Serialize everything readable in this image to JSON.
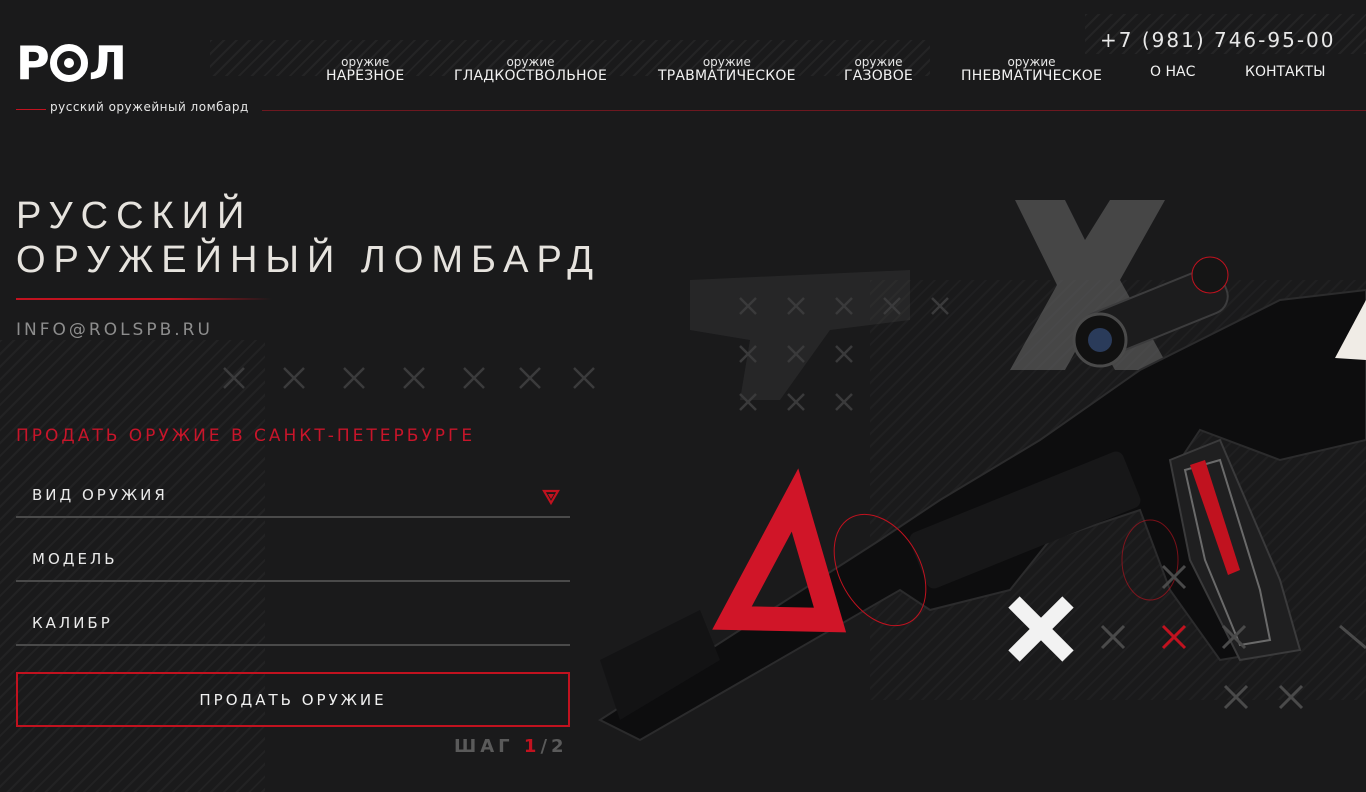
{
  "header": {
    "logo_text": "РОЛ",
    "logo_subtitle": "русский оружейный ломбард",
    "phone": "+7 (981) 746-95-00",
    "nav": [
      {
        "small": "оружие",
        "label": "НАРЕЗНОЕ"
      },
      {
        "small": "оружие",
        "label": "ГЛАДКОСТВОЛЬНОЕ"
      },
      {
        "small": "оружие",
        "label": "ТРАВМАТИЧЕСКОЕ"
      },
      {
        "small": "оружие",
        "label": "ГАЗОВОЕ"
      },
      {
        "small": "оружие",
        "label": "ПНЕВМАТИЧЕСКОЕ"
      }
    ],
    "about": "О НАС",
    "contacts": "КОНТАКТЫ"
  },
  "hero": {
    "title_line1": "РУССКИЙ",
    "title_line2": "ОРУЖЕЙНЫЙ ЛОМБАРД",
    "email": "INFO@ROLSPB.RU"
  },
  "form": {
    "title": "ПРОДАТЬ ОРУЖИЕ В САНКТ-ПЕТЕРБУРГЕ",
    "weapon_type_label": "ВИД ОРУЖИЯ",
    "model_label": "МОДЕЛЬ",
    "caliber_label": "КАЛИБР",
    "submit_label": "ПРОДАТЬ ОРУЖИЕ",
    "step_prefix": "ШАГ",
    "step_current": "1",
    "step_total": "/2"
  },
  "colors": {
    "accent": "#c1121f",
    "background": "#1a1a1b",
    "text": "#e6e3de"
  },
  "icons": [
    "dropdown-caret-icon",
    "x-mark-icon",
    "triangle-icon",
    "scope-icon"
  ]
}
